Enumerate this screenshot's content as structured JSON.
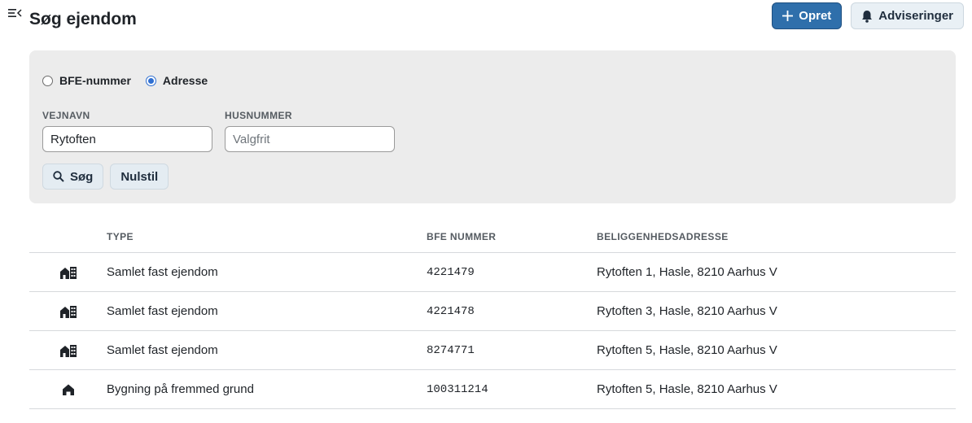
{
  "header": {
    "title": "Søg ejendom",
    "menu_icon": "menu-collapse-icon",
    "create_label": "Opret",
    "create_icon": "plus-icon",
    "notifications_label": "Adviseringer",
    "notifications_icon": "bell-icon"
  },
  "search": {
    "radio_options": [
      {
        "label": "BFE-nummer",
        "checked": false
      },
      {
        "label": "Adresse",
        "checked": true
      }
    ],
    "street_label": "VEJNAVN",
    "street_value": "Rytoften",
    "house_label": "HUSNUMMER",
    "house_placeholder": "Valgfrit",
    "search_label": "Søg",
    "search_icon": "search-icon",
    "reset_label": "Nulstil"
  },
  "results": {
    "columns": [
      "TYPE",
      "BFE NUMMER",
      "BELIGGENHEDSADRESSE"
    ],
    "rows": [
      {
        "icon": "property-buildings-icon",
        "type": "Samlet fast ejendom",
        "bfe": "4221479",
        "address": "Rytoften 1, Hasle, 8210 Aarhus V"
      },
      {
        "icon": "property-buildings-icon",
        "type": "Samlet fast ejendom",
        "bfe": "4221478",
        "address": "Rytoften 3, Hasle, 8210 Aarhus V"
      },
      {
        "icon": "property-buildings-icon",
        "type": "Samlet fast ejendom",
        "bfe": "8274771",
        "address": "Rytoften 5, Hasle, 8210 Aarhus V"
      },
      {
        "icon": "house-icon",
        "type": "Bygning på fremmed grund",
        "bfe": "100311214",
        "address": "Rytoften 5, Hasle, 8210 Aarhus V"
      }
    ]
  },
  "colors": {
    "primary": "#2f6fab",
    "panel_bg": "#ececec",
    "radio_accent": "#2f6fd1"
  }
}
